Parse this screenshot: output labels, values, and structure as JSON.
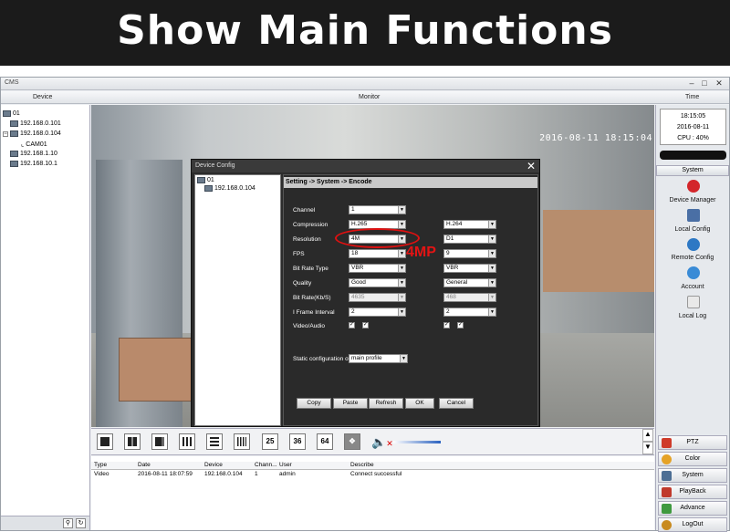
{
  "banner": {
    "title": "Show Main Functions"
  },
  "app": {
    "title": "CMS"
  },
  "headers": {
    "device": "Device",
    "monitor": "Monitor",
    "time": "Time"
  },
  "device_tree": [
    {
      "label": "01",
      "indent": 0
    },
    {
      "label": "192.168.0.101",
      "indent": 1
    },
    {
      "label": "192.168.0.104",
      "indent": 1
    },
    {
      "label": "CAM01",
      "indent": 2
    },
    {
      "label": "192.168.1.10",
      "indent": 1
    },
    {
      "label": "192.168.10.1",
      "indent": 1
    }
  ],
  "osd": {
    "timestamp": "2016-08-11 18:15:04"
  },
  "clock": {
    "time": "18:15:05",
    "date": "2016-08-11",
    "cpu": "CPU : 40%"
  },
  "right_menu": {
    "system_tab": "System",
    "items": [
      {
        "label": "Device Manager",
        "icon": "device-manager-icon",
        "color": "#d3262b"
      },
      {
        "label": "Local Config",
        "icon": "local-config-icon",
        "color": "#4a6fa5"
      },
      {
        "label": "Remote Config",
        "icon": "remote-config-icon",
        "color": "#2d78c4"
      },
      {
        "label": "Account",
        "icon": "account-icon",
        "color": "#3a8bd6"
      },
      {
        "label": "Local Log",
        "icon": "local-log-icon",
        "color": "#e9e9e9"
      }
    ],
    "bottom_tabs": [
      {
        "label": "PTZ",
        "icon": "ptz-icon",
        "color": "#cf3b2a"
      },
      {
        "label": "Color",
        "icon": "color-icon",
        "color": "#e5a226"
      },
      {
        "label": "System",
        "icon": "system-icon",
        "color": "#4c6e94"
      },
      {
        "label": "PlayBack",
        "icon": "playback-icon",
        "color": "#c0392b"
      },
      {
        "label": "Advance",
        "icon": "advance-icon",
        "color": "#3f9a3f"
      },
      {
        "label": "LogOut",
        "icon": "logout-icon",
        "color": "#c88a1f"
      }
    ]
  },
  "toolbar": {
    "layouts": [
      "1",
      "4",
      "6",
      "9",
      "8",
      "16",
      "25",
      "36",
      "64"
    ]
  },
  "log": {
    "columns": [
      "Type",
      "Date",
      "Device",
      "Chann...",
      "User",
      "Describe"
    ],
    "rows": [
      [
        "Video",
        "2016-08-11 18:07:59",
        "192.168.0.104",
        "1",
        "admin",
        "Connect successful"
      ]
    ]
  },
  "dialog": {
    "title": "Device Config",
    "tree": [
      {
        "label": "01"
      },
      {
        "label": "192.168.0.104"
      }
    ],
    "breadcrumb": "Setting -> System -> Encode",
    "fields": [
      {
        "label": "Channel",
        "main": "1",
        "sub": ""
      },
      {
        "label": "Compression",
        "main": "H.265",
        "sub": "H.264"
      },
      {
        "label": "Resolution",
        "main": "4M",
        "sub": "D1"
      },
      {
        "label": "FPS",
        "main": "18",
        "sub": "9"
      },
      {
        "label": "Bit Rate Type",
        "main": "VBR",
        "sub": "VBR"
      },
      {
        "label": "Quality",
        "main": "Good",
        "sub": "General"
      },
      {
        "label": "Bit Rate(Kb/S)",
        "main": "4635",
        "sub": "468"
      },
      {
        "label": "I Frame Interval",
        "main": "2",
        "sub": "2"
      },
      {
        "label": "Video/Audio",
        "main": "",
        "sub": ""
      }
    ],
    "static_label": "Static configuration of",
    "static_value": "main profile",
    "buttons": [
      "Copy",
      "Paste",
      "Refresh",
      "OK",
      "Cancel"
    ],
    "annotation": "4MP"
  }
}
